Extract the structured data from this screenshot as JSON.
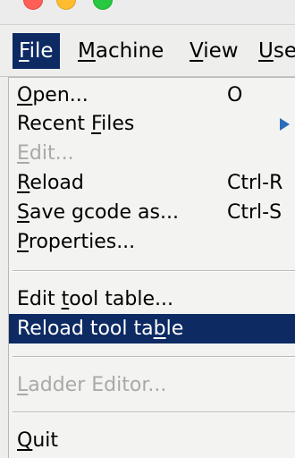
{
  "window": {
    "controls": [
      "close-button",
      "minimize-button",
      "zoom-button"
    ]
  },
  "menubar": {
    "menus": [
      {
        "label": "File",
        "mnemonic": "F",
        "rest": "ile",
        "active": true
      },
      {
        "label": "Machine",
        "mnemonic": "M",
        "rest": "achine"
      },
      {
        "label": "View",
        "mnemonic": "V",
        "rest": "iew"
      },
      {
        "label": "Use",
        "mnemonic": "U",
        "rest": "se"
      }
    ]
  },
  "file_menu": {
    "items": [
      {
        "pre": "",
        "mnemonic": "O",
        "post": "pen...",
        "accelerator": "O",
        "enabled": true
      },
      {
        "pre": "Recent ",
        "mnemonic": "F",
        "post": "iles",
        "accelerator": "",
        "enabled": true,
        "submenu": true
      },
      {
        "pre": "",
        "mnemonic": "E",
        "post": "dit...",
        "accelerator": "",
        "enabled": false
      },
      {
        "pre": "",
        "mnemonic": "R",
        "post": "eload",
        "accelerator": "Ctrl-R",
        "enabled": true
      },
      {
        "pre": "",
        "mnemonic": "S",
        "post": "ave gcode as...",
        "accelerator": "Ctrl-S",
        "enabled": true
      },
      {
        "pre": "",
        "mnemonic": "P",
        "post": "roperties...",
        "accelerator": "",
        "enabled": true
      },
      {
        "pre": "Edit ",
        "mnemonic": "t",
        "post": "ool table...",
        "accelerator": "",
        "enabled": true
      },
      {
        "pre": "Reload tool ta",
        "mnemonic": "b",
        "post": "le",
        "accelerator": "",
        "enabled": true,
        "highlighted": true
      },
      {
        "pre": "",
        "mnemonic": "L",
        "post": "adder Editor...",
        "accelerator": "",
        "enabled": false
      },
      {
        "pre": "",
        "mnemonic": "Q",
        "post": "uit",
        "accelerator": "",
        "enabled": true
      }
    ]
  },
  "colors": {
    "highlight": "#0d2a63",
    "menu_background": "#f3f3f1",
    "disabled_text": "#a9a9a6",
    "submenu_arrow": "#2a6db8"
  }
}
